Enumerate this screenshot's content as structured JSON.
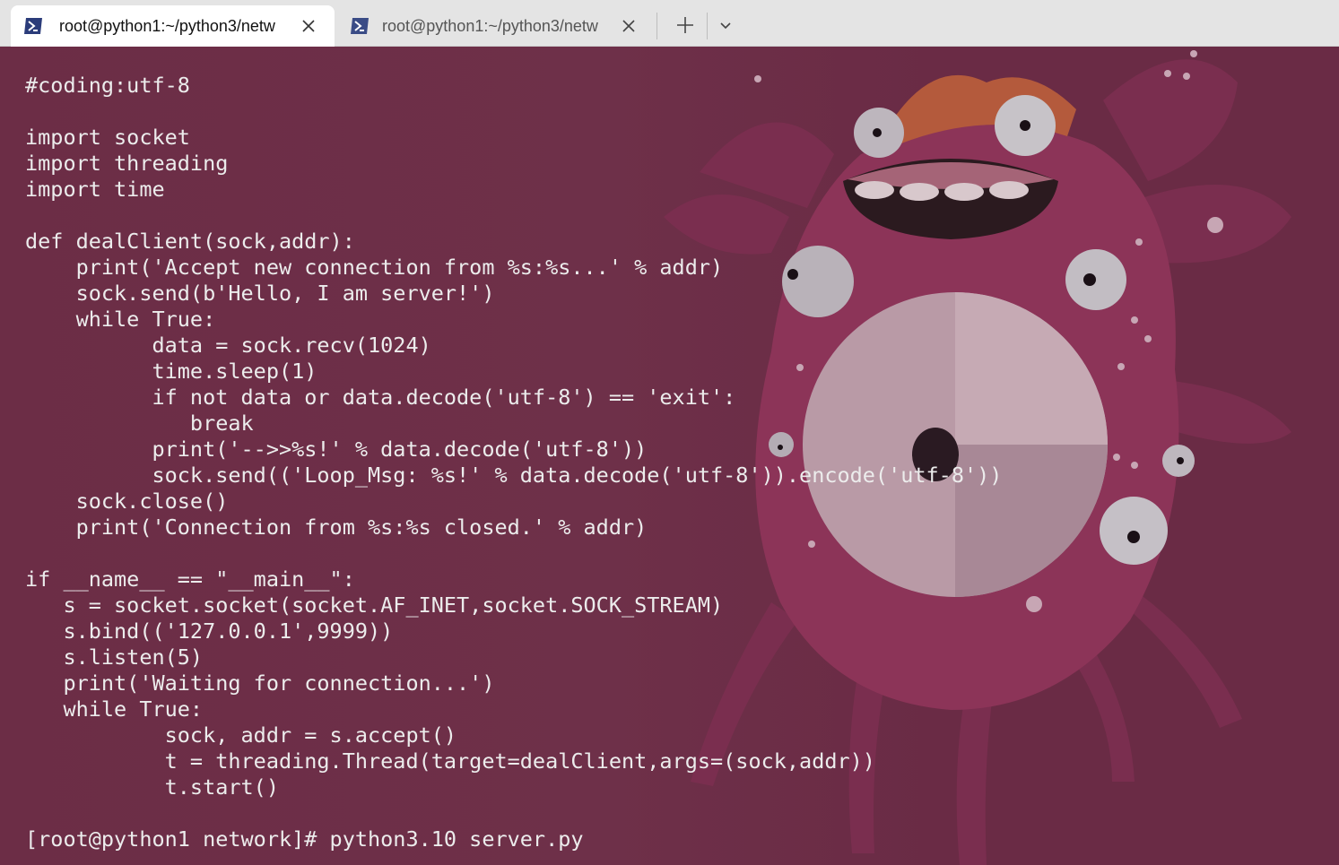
{
  "tabs": [
    {
      "title": "root@python1:~/python3/netw",
      "active": true
    },
    {
      "title": "root@python1:~/python3/netw",
      "active": false
    }
  ],
  "icons": {
    "tab": "powershell-icon",
    "close": "close-icon",
    "new_tab": "plus-icon",
    "dropdown": "chevron-down-icon"
  },
  "colors": {
    "terminal_bg": "#6a2d47",
    "tab_bar_bg": "#e4e4e4",
    "text": "#ececec"
  },
  "terminal": {
    "lines": [
      "#coding:utf-8",
      "",
      "import socket",
      "import threading",
      "import time",
      "",
      "def dealClient(sock,addr):",
      "    print('Accept new connection from %s:%s...' % addr)",
      "    sock.send(b'Hello, I am server!')",
      "    while True:",
      "          data = sock.recv(1024)",
      "          time.sleep(1)",
      "          if not data or data.decode('utf-8') == 'exit':",
      "             break",
      "          print('-->>%s!' % data.decode('utf-8'))",
      "          sock.send(('Loop_Msg: %s!' % data.decode('utf-8')).encode('utf-8'))",
      "    sock.close()",
      "    print('Connection from %s:%s closed.' % addr)",
      "",
      "if __name__ == \"__main__\":",
      "   s = socket.socket(socket.AF_INET,socket.SOCK_STREAM)",
      "   s.bind(('127.0.0.1',9999))",
      "   s.listen(5)",
      "   print('Waiting for connection...')",
      "   while True:",
      "           sock, addr = s.accept()",
      "           t = threading.Thread(target=dealClient,args=(sock,addr))",
      "           t.start()",
      "",
      "[root@python1 network]# python3.10 server.py"
    ]
  }
}
